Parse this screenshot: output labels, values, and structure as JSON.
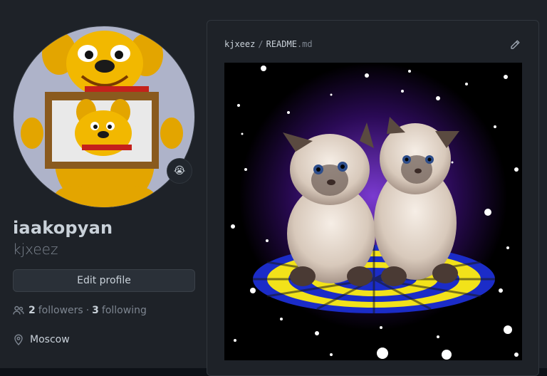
{
  "profile": {
    "display_name": "iaakopyan",
    "username": "kjxeez",
    "edit_button_label": "Edit profile",
    "followers_count": "2",
    "followers_label": "followers",
    "separator": "·",
    "following_count": "3",
    "following_label": "following",
    "location": "Moscow",
    "status_emoji": "😭"
  },
  "readme": {
    "owner": "kjxeez",
    "separator": "/",
    "file_name": "README",
    "file_ext": ".md"
  },
  "icons": {
    "people": "people-icon",
    "location": "location-pin-icon",
    "pencil": "pencil-icon"
  },
  "colors": {
    "background": "#1e2228",
    "border": "#30363d",
    "muted_text": "#7d8590",
    "text": "#c9d1d9"
  }
}
